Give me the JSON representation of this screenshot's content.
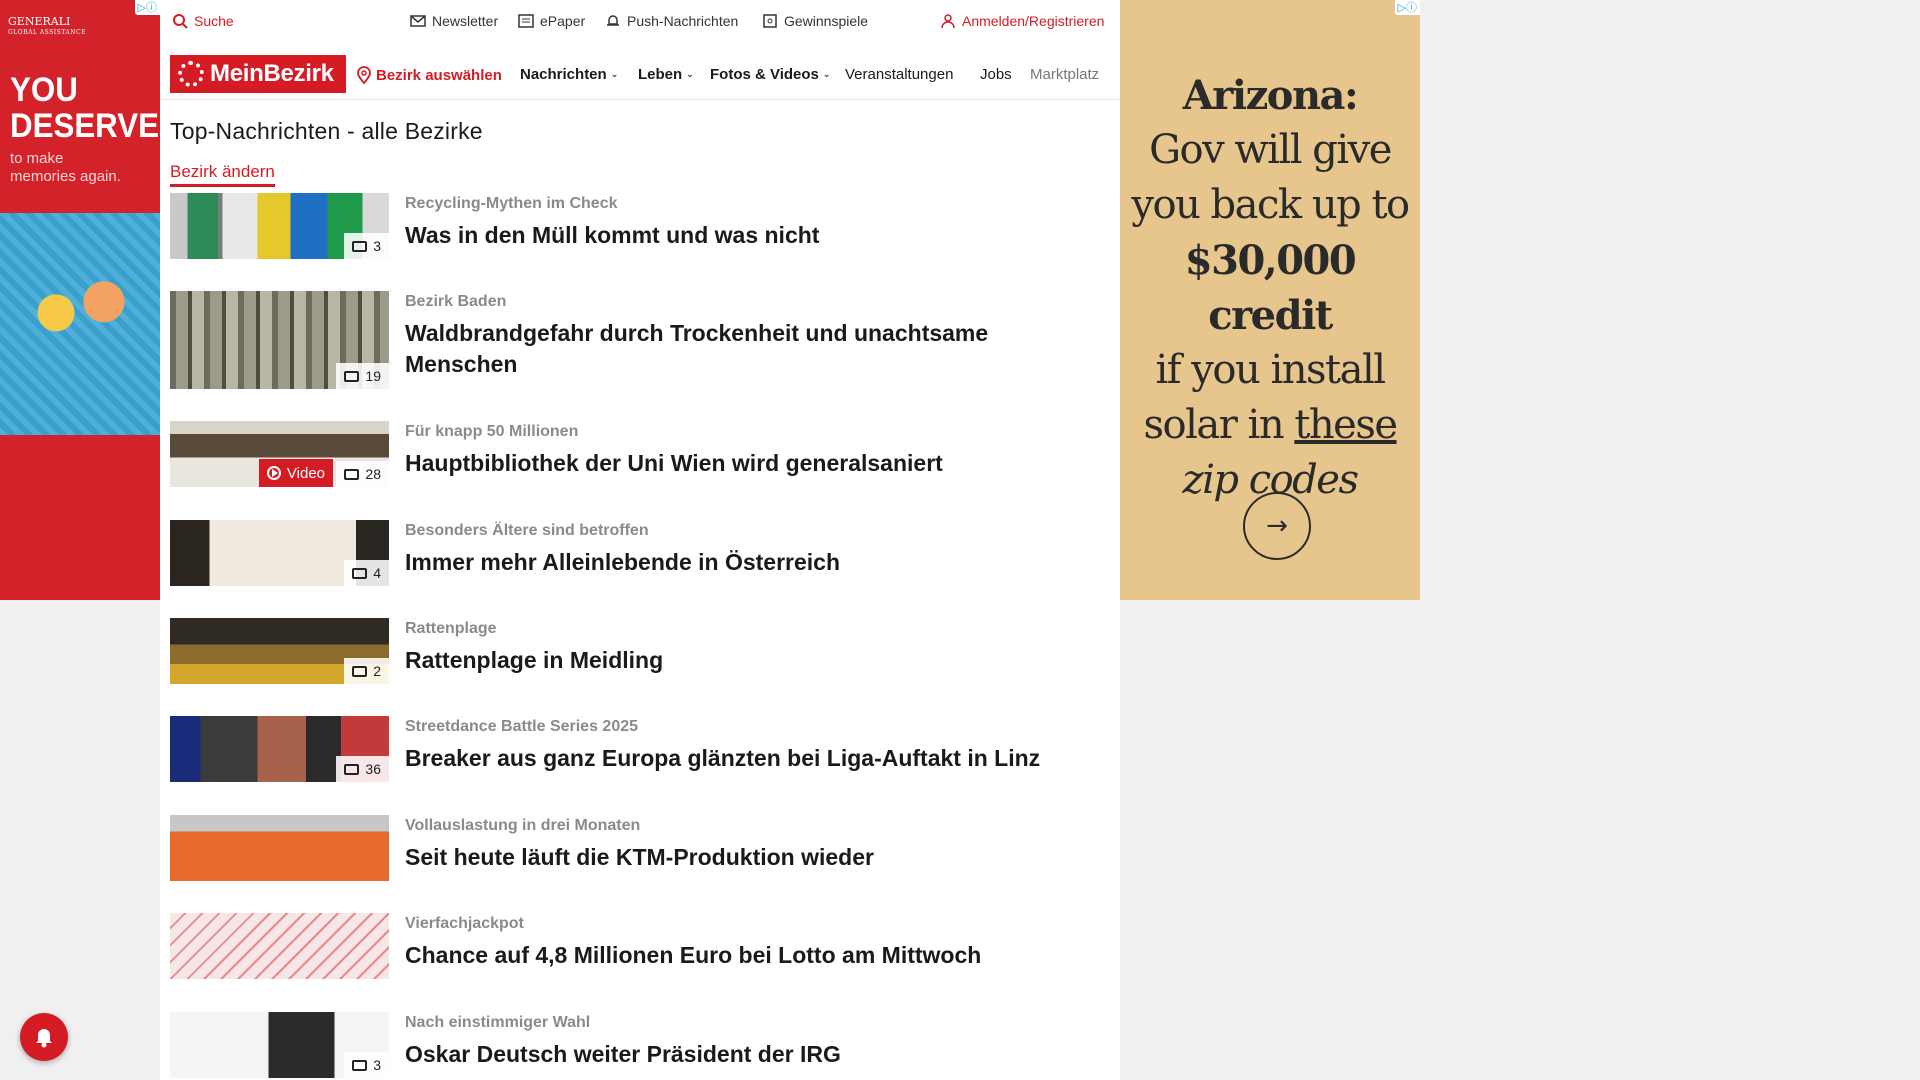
{
  "ads": {
    "left": {
      "badge": "▷ⓘ",
      "brand": "GENERALI",
      "brand_sub": "GLOBAL ASSISTANCE",
      "headline_line1": "YOU",
      "headline_line2": "DESERVE",
      "sub_line1": "to make",
      "sub_line2": "memories again."
    },
    "right": {
      "badge": "▷ⓘ",
      "line1": "Arizona:",
      "line2": "Gov will give",
      "line3": "you back up to",
      "line4": "$30,000 credit",
      "line5": "if you install",
      "line6_a": "solar in ",
      "line6_b": "these",
      "line7": "zip codes",
      "cta_icon": "arrow-right-icon",
      "bg_color": "#e6c68d"
    }
  },
  "topbar": {
    "search": "Suche",
    "newsletter": "Newsletter",
    "epaper": "ePaper",
    "push": "Push-Nachrichten",
    "gewinnspiele": "Gewinnspiele",
    "login": "Anmelden/Registrieren"
  },
  "navbar": {
    "logo": "MeinBezirk",
    "bezirk": "Bezirk auswählen",
    "items": [
      "Nachrichten",
      "Leben",
      "Fotos & Videos",
      "Veranstaltungen",
      "Jobs",
      "Marktplatz"
    ]
  },
  "page": {
    "title": "Top-Nachrichten - alle Bezirke",
    "change_link": "Bezirk ändern"
  },
  "articles": [
    {
      "kicker": "Recycling-Mythen im Check",
      "headline": "Was in den Müll kommt und was nicht",
      "count": "3"
    },
    {
      "kicker": "Bezirk Baden",
      "headline": "Waldbrandgefahr durch Trockenheit und unachtsame Menschen",
      "count": "19"
    },
    {
      "kicker": "Für knapp 50 Millionen",
      "headline": "Hauptbibliothek der Uni Wien wird generalsaniert",
      "count": "28",
      "video": "Video"
    },
    {
      "kicker": "Besonders Ältere sind betroffen",
      "headline": "Immer mehr Alleinlebende in Österreich",
      "count": "4"
    },
    {
      "kicker": "Rattenplage",
      "headline": "Rattenplage in Meidling",
      "count": "2"
    },
    {
      "kicker": "Streetdance Battle Series 2025",
      "headline": "Breaker aus ganz Europa glänzten bei Liga-Auftakt in Linz",
      "count": "36"
    },
    {
      "kicker": "Vollauslastung in drei Monaten",
      "headline": "Seit heute läuft die KTM-Produktion wieder",
      "count": ""
    },
    {
      "kicker": "Vierfachjackpot",
      "headline": "Chance auf 4,8 Millionen Euro bei Lotto am Mittwoch",
      "count": ""
    },
    {
      "kicker": "Nach einstimmiger Wahl",
      "headline": "Oskar Deutsch weiter Präsident der IRG",
      "count": "3"
    }
  ],
  "colors": {
    "brand_red": "#d51c24",
    "kicker_gray": "#8a8a8a"
  }
}
